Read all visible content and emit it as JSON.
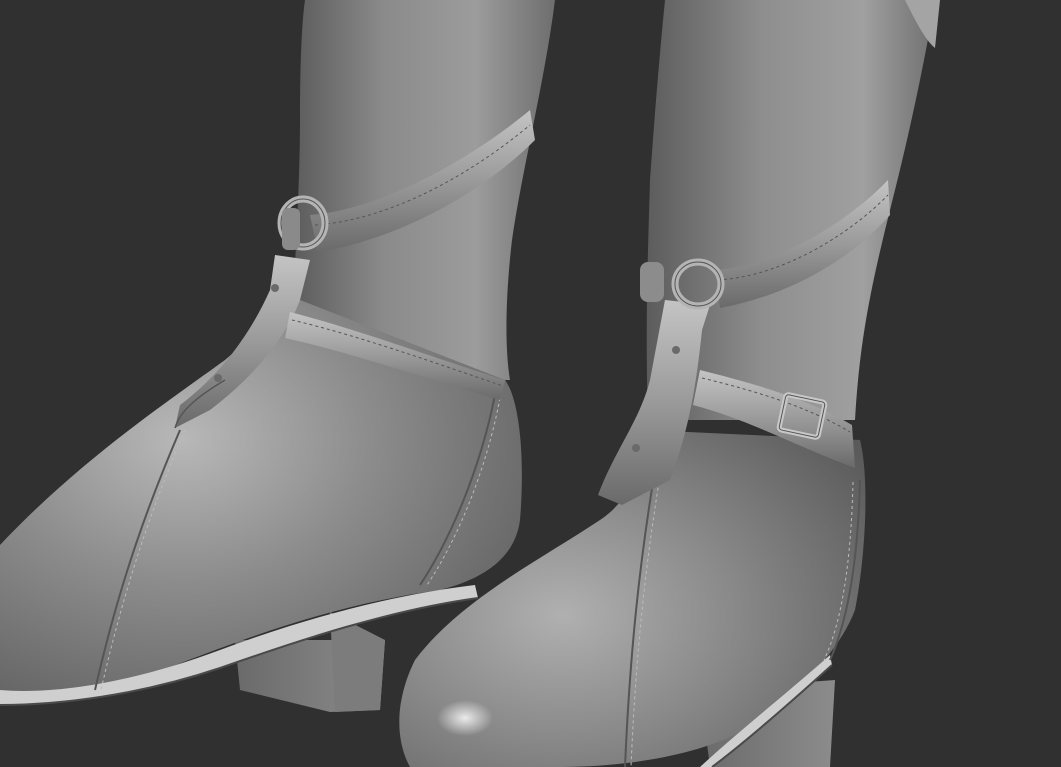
{
  "scene": {
    "subject": "boots-sculpt",
    "background_color": "#303030",
    "material_color": "#8e8e8e",
    "highlight_color": "#dcdcdc",
    "shadow_color": "#3c3c3c",
    "objects": {
      "left_boot": {
        "has_ring": true,
        "has_buckle": false
      },
      "right_boot": {
        "has_ring": true,
        "has_buckle": true
      }
    }
  }
}
